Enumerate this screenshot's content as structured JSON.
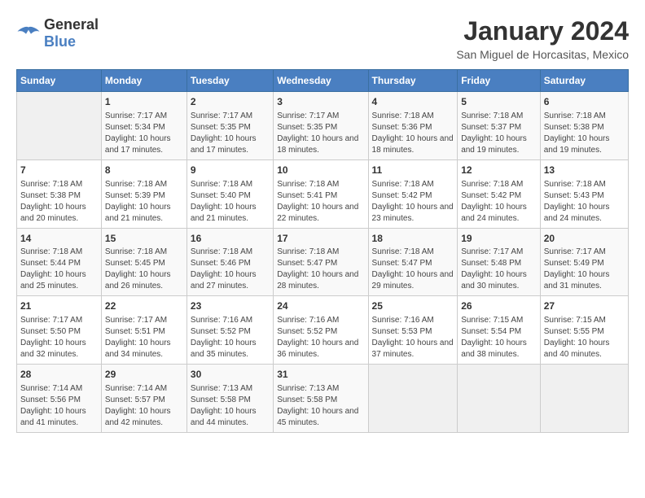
{
  "header": {
    "logo_line1": "General",
    "logo_line2": "Blue",
    "month_title": "January 2024",
    "location": "San Miguel de Horcasitas, Mexico"
  },
  "days_of_week": [
    "Sunday",
    "Monday",
    "Tuesday",
    "Wednesday",
    "Thursday",
    "Friday",
    "Saturday"
  ],
  "weeks": [
    [
      {
        "day": "",
        "sunrise": "",
        "sunset": "",
        "daylight": ""
      },
      {
        "day": "1",
        "sunrise": "Sunrise: 7:17 AM",
        "sunset": "Sunset: 5:34 PM",
        "daylight": "Daylight: 10 hours and 17 minutes."
      },
      {
        "day": "2",
        "sunrise": "Sunrise: 7:17 AM",
        "sunset": "Sunset: 5:35 PM",
        "daylight": "Daylight: 10 hours and 17 minutes."
      },
      {
        "day": "3",
        "sunrise": "Sunrise: 7:17 AM",
        "sunset": "Sunset: 5:35 PM",
        "daylight": "Daylight: 10 hours and 18 minutes."
      },
      {
        "day": "4",
        "sunrise": "Sunrise: 7:18 AM",
        "sunset": "Sunset: 5:36 PM",
        "daylight": "Daylight: 10 hours and 18 minutes."
      },
      {
        "day": "5",
        "sunrise": "Sunrise: 7:18 AM",
        "sunset": "Sunset: 5:37 PM",
        "daylight": "Daylight: 10 hours and 19 minutes."
      },
      {
        "day": "6",
        "sunrise": "Sunrise: 7:18 AM",
        "sunset": "Sunset: 5:38 PM",
        "daylight": "Daylight: 10 hours and 19 minutes."
      }
    ],
    [
      {
        "day": "7",
        "sunrise": "Sunrise: 7:18 AM",
        "sunset": "Sunset: 5:38 PM",
        "daylight": "Daylight: 10 hours and 20 minutes."
      },
      {
        "day": "8",
        "sunrise": "Sunrise: 7:18 AM",
        "sunset": "Sunset: 5:39 PM",
        "daylight": "Daylight: 10 hours and 21 minutes."
      },
      {
        "day": "9",
        "sunrise": "Sunrise: 7:18 AM",
        "sunset": "Sunset: 5:40 PM",
        "daylight": "Daylight: 10 hours and 21 minutes."
      },
      {
        "day": "10",
        "sunrise": "Sunrise: 7:18 AM",
        "sunset": "Sunset: 5:41 PM",
        "daylight": "Daylight: 10 hours and 22 minutes."
      },
      {
        "day": "11",
        "sunrise": "Sunrise: 7:18 AM",
        "sunset": "Sunset: 5:42 PM",
        "daylight": "Daylight: 10 hours and 23 minutes."
      },
      {
        "day": "12",
        "sunrise": "Sunrise: 7:18 AM",
        "sunset": "Sunset: 5:42 PM",
        "daylight": "Daylight: 10 hours and 24 minutes."
      },
      {
        "day": "13",
        "sunrise": "Sunrise: 7:18 AM",
        "sunset": "Sunset: 5:43 PM",
        "daylight": "Daylight: 10 hours and 24 minutes."
      }
    ],
    [
      {
        "day": "14",
        "sunrise": "Sunrise: 7:18 AM",
        "sunset": "Sunset: 5:44 PM",
        "daylight": "Daylight: 10 hours and 25 minutes."
      },
      {
        "day": "15",
        "sunrise": "Sunrise: 7:18 AM",
        "sunset": "Sunset: 5:45 PM",
        "daylight": "Daylight: 10 hours and 26 minutes."
      },
      {
        "day": "16",
        "sunrise": "Sunrise: 7:18 AM",
        "sunset": "Sunset: 5:46 PM",
        "daylight": "Daylight: 10 hours and 27 minutes."
      },
      {
        "day": "17",
        "sunrise": "Sunrise: 7:18 AM",
        "sunset": "Sunset: 5:47 PM",
        "daylight": "Daylight: 10 hours and 28 minutes."
      },
      {
        "day": "18",
        "sunrise": "Sunrise: 7:18 AM",
        "sunset": "Sunset: 5:47 PM",
        "daylight": "Daylight: 10 hours and 29 minutes."
      },
      {
        "day": "19",
        "sunrise": "Sunrise: 7:17 AM",
        "sunset": "Sunset: 5:48 PM",
        "daylight": "Daylight: 10 hours and 30 minutes."
      },
      {
        "day": "20",
        "sunrise": "Sunrise: 7:17 AM",
        "sunset": "Sunset: 5:49 PM",
        "daylight": "Daylight: 10 hours and 31 minutes."
      }
    ],
    [
      {
        "day": "21",
        "sunrise": "Sunrise: 7:17 AM",
        "sunset": "Sunset: 5:50 PM",
        "daylight": "Daylight: 10 hours and 32 minutes."
      },
      {
        "day": "22",
        "sunrise": "Sunrise: 7:17 AM",
        "sunset": "Sunset: 5:51 PM",
        "daylight": "Daylight: 10 hours and 34 minutes."
      },
      {
        "day": "23",
        "sunrise": "Sunrise: 7:16 AM",
        "sunset": "Sunset: 5:52 PM",
        "daylight": "Daylight: 10 hours and 35 minutes."
      },
      {
        "day": "24",
        "sunrise": "Sunrise: 7:16 AM",
        "sunset": "Sunset: 5:52 PM",
        "daylight": "Daylight: 10 hours and 36 minutes."
      },
      {
        "day": "25",
        "sunrise": "Sunrise: 7:16 AM",
        "sunset": "Sunset: 5:53 PM",
        "daylight": "Daylight: 10 hours and 37 minutes."
      },
      {
        "day": "26",
        "sunrise": "Sunrise: 7:15 AM",
        "sunset": "Sunset: 5:54 PM",
        "daylight": "Daylight: 10 hours and 38 minutes."
      },
      {
        "day": "27",
        "sunrise": "Sunrise: 7:15 AM",
        "sunset": "Sunset: 5:55 PM",
        "daylight": "Daylight: 10 hours and 40 minutes."
      }
    ],
    [
      {
        "day": "28",
        "sunrise": "Sunrise: 7:14 AM",
        "sunset": "Sunset: 5:56 PM",
        "daylight": "Daylight: 10 hours and 41 minutes."
      },
      {
        "day": "29",
        "sunrise": "Sunrise: 7:14 AM",
        "sunset": "Sunset: 5:57 PM",
        "daylight": "Daylight: 10 hours and 42 minutes."
      },
      {
        "day": "30",
        "sunrise": "Sunrise: 7:13 AM",
        "sunset": "Sunset: 5:58 PM",
        "daylight": "Daylight: 10 hours and 44 minutes."
      },
      {
        "day": "31",
        "sunrise": "Sunrise: 7:13 AM",
        "sunset": "Sunset: 5:58 PM",
        "daylight": "Daylight: 10 hours and 45 minutes."
      },
      {
        "day": "",
        "sunrise": "",
        "sunset": "",
        "daylight": ""
      },
      {
        "day": "",
        "sunrise": "",
        "sunset": "",
        "daylight": ""
      },
      {
        "day": "",
        "sunrise": "",
        "sunset": "",
        "daylight": ""
      }
    ]
  ]
}
